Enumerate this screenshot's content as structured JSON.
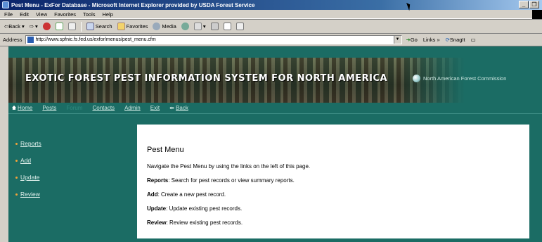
{
  "window": {
    "title": "Pest Menu - ExFor Database - Microsoft Internet Explorer provided by USDA Forest Service",
    "buttons": [
      "_",
      "❒"
    ]
  },
  "menubar": [
    "File",
    "Edit",
    "View",
    "Favorites",
    "Tools",
    "Help"
  ],
  "toolbar": {
    "back": "⇦Back",
    "forward": "⇨",
    "search": "Search",
    "favorites": "Favorites",
    "media": "Media"
  },
  "addressbar": {
    "label": "Address",
    "url": "http://www.spfnic.fs.fed.us/exfor/menus/pest_menu.cfm",
    "go": "Go",
    "links": "Links",
    "chevron": "»",
    "snagit": "SnagIt"
  },
  "banner": {
    "title": "EXOTIC FOREST PEST INFORMATION SYSTEM FOR NORTH AMERICA",
    "commission": "North American Forest Commission"
  },
  "nav": {
    "home": "Home",
    "pests": "Pests",
    "forum": "Forum",
    "contacts": "Contacts",
    "admin": "Admin",
    "exit": "Exit",
    "back": "Back"
  },
  "sidebar": {
    "items": [
      "Reports",
      "Add",
      "Update",
      "Review"
    ]
  },
  "content": {
    "title": "Pest Menu",
    "intro": "Navigate the Pest Menu by using the links on the left of this page.",
    "lines": [
      {
        "term": "Reports",
        "text": ": Search for pest records or view summary reports."
      },
      {
        "term": "Add",
        "text": ": Create a new pest record."
      },
      {
        "term": "Update",
        "text": ": Update existing pest records."
      },
      {
        "term": "Review",
        "text": ": Review existing pest records."
      }
    ]
  },
  "colors": {
    "page_background": "#1b6c64",
    "bullet": "#f0a23a",
    "titlebar": "#0a246a"
  }
}
